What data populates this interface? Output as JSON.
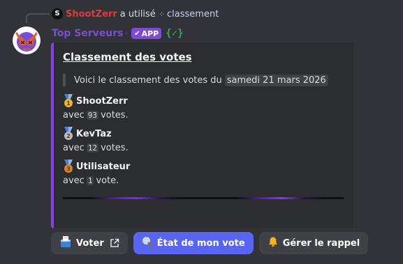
{
  "reply": {
    "avatar_letter": "S",
    "username": "ShootZerr",
    "action": "a utilisé",
    "command": "classement"
  },
  "message": {
    "author": "Top Serveurs",
    "badge": "APP",
    "code_mark": "{✓}"
  },
  "embed": {
    "accent_color": "#8a3fe0",
    "title": "Classement des votes",
    "intro": "Voici le classement des votes du",
    "date": "samedi 21 mars 2026",
    "entries": [
      {
        "rank": "1",
        "name": "ShootZerr",
        "prefix": "avec",
        "count": "93",
        "suffix": "votes."
      },
      {
        "rank": "2",
        "name": "KevTaz",
        "prefix": "avec",
        "count": "12",
        "suffix": "votes."
      },
      {
        "rank": "3",
        "name": "Utilisateur",
        "prefix": "avec",
        "count": "1",
        "suffix": "vote."
      }
    ]
  },
  "buttons": {
    "vote": "Voter",
    "status": "État de mon vote",
    "reminder": "Gérer le rappel"
  },
  "colors": {
    "primary": "#5865f2",
    "app_badge": "#7d4bd4",
    "reply_user": "#e03b3b"
  }
}
